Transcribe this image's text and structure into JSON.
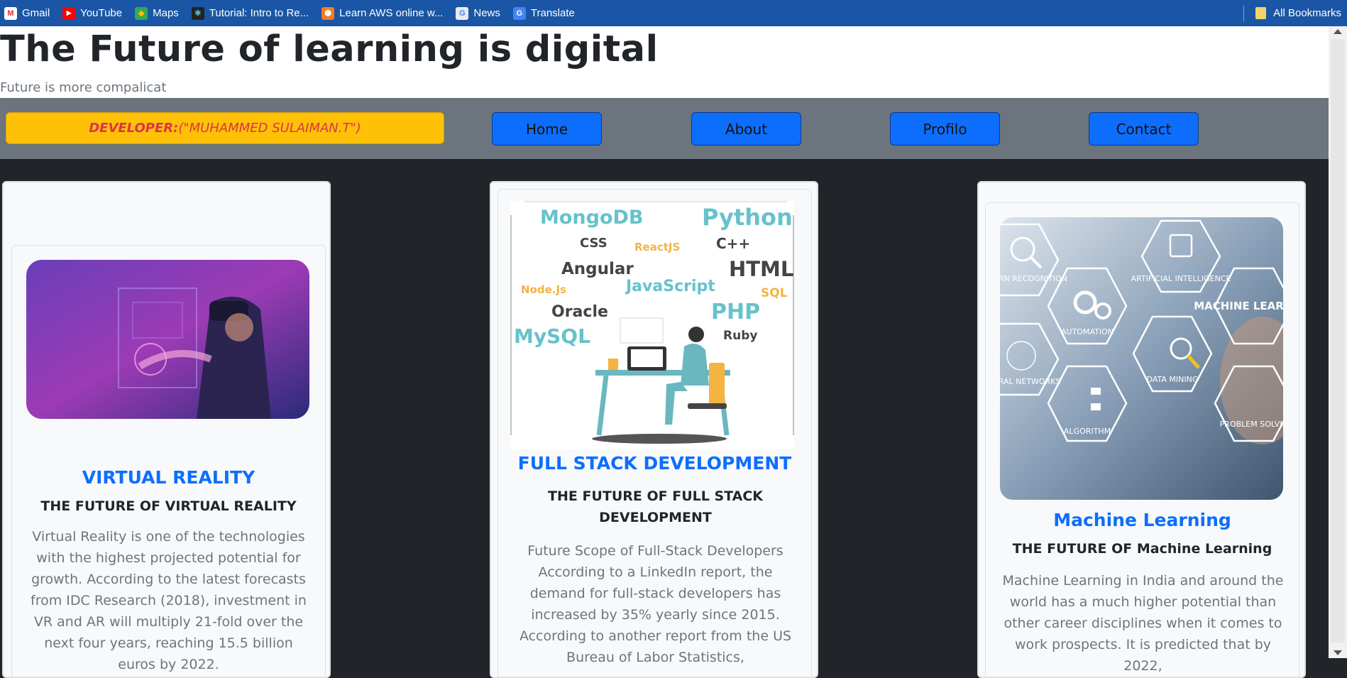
{
  "bookmarks": {
    "items": [
      {
        "label": "Gmail",
        "icon": "gmail-icon"
      },
      {
        "label": "YouTube",
        "icon": "youtube-icon"
      },
      {
        "label": "Maps",
        "icon": "maps-icon"
      },
      {
        "label": "Tutorial: Intro to Re...",
        "icon": "react-icon"
      },
      {
        "label": "Learn AWS online w...",
        "icon": "aws-icon"
      },
      {
        "label": "News",
        "icon": "news-icon"
      },
      {
        "label": "Translate",
        "icon": "translate-icon"
      }
    ],
    "all_label": "All Bookmarks"
  },
  "header": {
    "title": "The Future of learning is digital",
    "subtitle": "Future is more compalicat"
  },
  "nav": {
    "developer_prefix": "DEVELOPER:",
    "developer_name": "(\"MUHAMMED SULAIMAN.T\")",
    "items": [
      "Home",
      "About",
      "Profilo",
      "Contact"
    ]
  },
  "cards": [
    {
      "title": "VIRTUAL REALITY",
      "subtitle": "THE FUTURE OF VIRTUAL REALITY",
      "text": "Virtual Reality is one of the technologies with the highest projected potential for growth. According to the latest forecasts from IDC Research (2018), investment in VR and AR will multiply 21-fold over the next four years, reaching 15.5 billion euros by 2022."
    },
    {
      "title": "FULL STACK DEVELOPMENT",
      "subtitle": "THE FUTURE OF FULL STACK DEVELOPMENT",
      "text": "Future Scope of Full-Stack Developers According to a LinkedIn report, the demand for full-stack developers has increased by 35% yearly since 2015. According to another report from the US Bureau of Labor Statistics,",
      "image_words": [
        "MongoDB",
        "Python",
        "CSS",
        "ReactJS",
        "C++",
        "Angular",
        "HTML",
        "Node.Js",
        "JavaScript",
        "SQL",
        "Oracle",
        "PHP",
        "MySQL",
        "Ruby"
      ]
    },
    {
      "title": "Machine Learning",
      "subtitle": "THE FUTURE OF Machine Learning",
      "text": "Machine Learning in India and around the world has a much higher potential than other career disciplines when it comes to work prospects. It is predicted that by 2022,",
      "image_labels": [
        "PATTERN RECOGNITION",
        "ARTIFICIAL INTELLIGENCE",
        "MACHINE LEARNING",
        "AUTOMATION",
        "NEURAL NETWORKS",
        "DATA MINING",
        "ALGORITHM",
        "PROBLEM SOLVING"
      ]
    }
  ]
}
